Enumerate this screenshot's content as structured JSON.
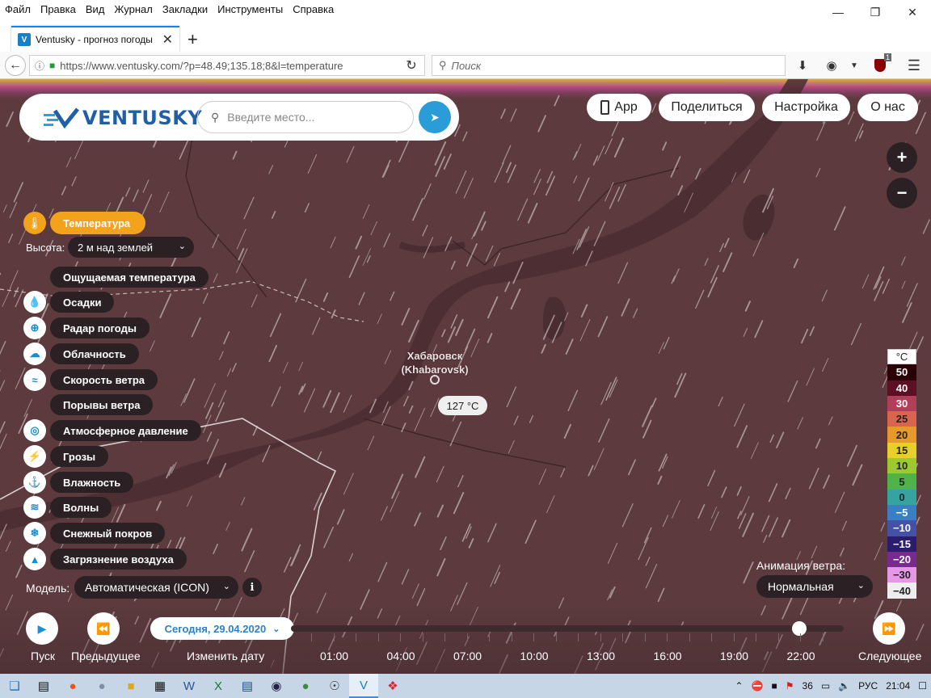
{
  "browser": {
    "menu": [
      "Файл",
      "Правка",
      "Вид",
      "Журнал",
      "Закладки",
      "Инструменты",
      "Справка"
    ],
    "tab_title": "Ventusky - прогноз погоды",
    "url": "https://www.ventusky.com/?p=48.49;135.18;8&l=temperature",
    "search_placeholder": "Поиск",
    "ublock_count": "1"
  },
  "site": {
    "logo_text": "VENTUSKY",
    "search_placeholder": "Введите место...",
    "top_buttons": {
      "app": "App",
      "share": "Поделиться",
      "settings": "Настройка",
      "about": "О нас"
    },
    "zoom_in": "+",
    "zoom_out": "−"
  },
  "layers": {
    "active": "Температура",
    "height_label": "Высота:",
    "height_value": "2 м над землей",
    "items": [
      "Ощущаемая температура",
      "Осадки",
      "Радар погоды",
      "Облачность",
      "Скорость ветра",
      "Порывы ветра",
      "Атмосферное давление",
      "Грозы",
      "Влажность",
      "Волны",
      "Снежный покров",
      "Загрязнение воздуха"
    ],
    "model_label": "Модель:",
    "model_value": "Автоматическая (ICON)",
    "info": "i"
  },
  "map": {
    "city_ru": "Хабаровск",
    "city_en": "(Khabarovsk)",
    "temp_value": "127 °C"
  },
  "wind_animation": {
    "label": "Анимация ветра:",
    "value": "Нормальная"
  },
  "legend": {
    "unit": "°C",
    "entries": [
      {
        "value": "50",
        "color": "#2a0006"
      },
      {
        "value": "40",
        "color": "#5c1023"
      },
      {
        "value": "30",
        "color": "#b0405a"
      },
      {
        "value": "25",
        "color": "#d9654e"
      },
      {
        "value": "20",
        "color": "#e79a2b"
      },
      {
        "value": "15",
        "color": "#e8cf2c"
      },
      {
        "value": "10",
        "color": "#9bc92e"
      },
      {
        "value": "5",
        "color": "#4fb34a"
      },
      {
        "value": "0",
        "color": "#35a3a0"
      },
      {
        "value": "−5",
        "color": "#3a7fc4"
      },
      {
        "value": "−10",
        "color": "#4451a6"
      },
      {
        "value": "−15",
        "color": "#2b1d6e"
      },
      {
        "value": "−20",
        "color": "#7a2a8c"
      },
      {
        "value": "−30",
        "color": "#e598e4"
      },
      {
        "value": "−40",
        "color": "#eeeeee"
      }
    ]
  },
  "timeline": {
    "play": "Пуск",
    "prev": "Предыдущее",
    "change_date": "Изменить дату",
    "next": "Следующее",
    "date": "Сегодня, 29.04.2020",
    "hours": [
      "01:00",
      "04:00",
      "07:00",
      "10:00",
      "13:00",
      "16:00",
      "19:00",
      "22:00"
    ],
    "current_hour": "22:00"
  },
  "taskbar": {
    "badge": "36",
    "lang": "РУС",
    "time": "21:04"
  }
}
